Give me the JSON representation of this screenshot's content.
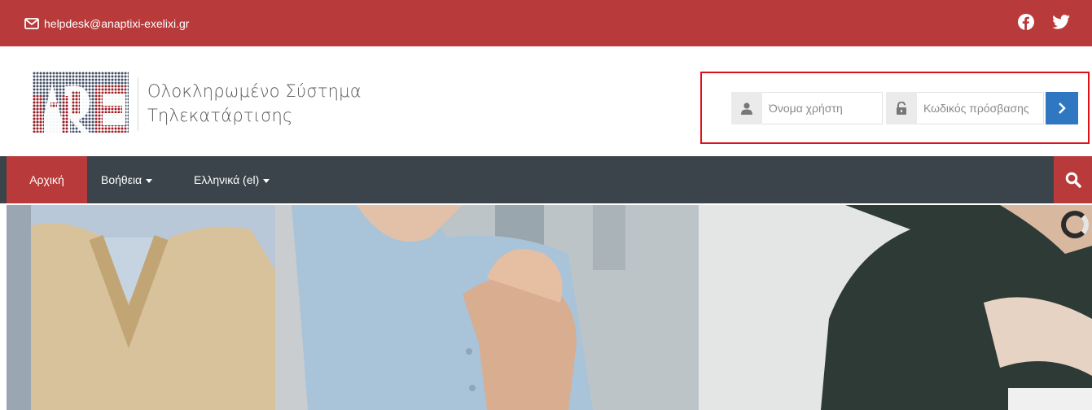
{
  "topbar": {
    "email": "helpdesk@anaptixi-exelixi.gr",
    "email_icon": "envelope-icon",
    "social": [
      {
        "name": "facebook",
        "icon": "facebook-icon"
      },
      {
        "name": "twitter",
        "icon": "twitter-icon"
      }
    ],
    "color": "#b83a3b"
  },
  "header": {
    "logo_icon": "logo-icon",
    "title_line1": "Ολοκληρωμένο Σύστημα",
    "title_line2": "Τηλεκατάρτισης"
  },
  "login": {
    "username_placeholder": "Όνομα χρήστη",
    "username_value": "",
    "password_placeholder": "Κωδικός πρόσβασης",
    "password_value": "",
    "user_icon": "user-icon",
    "lock_icon": "lock-icon",
    "submit_icon": "chevron-right-icon",
    "highlight_color": "#e0101a",
    "button_color": "#2f77c0"
  },
  "nav": {
    "home": "Αρχική",
    "help": "Βοήθεια",
    "language": "Ελληνικά (el)",
    "search_icon": "search-icon",
    "background": "#3a444a",
    "active_color": "#b83a3b"
  },
  "hero": {
    "image": "hero-photo-people",
    "loading_icon": "spinner-icon"
  }
}
